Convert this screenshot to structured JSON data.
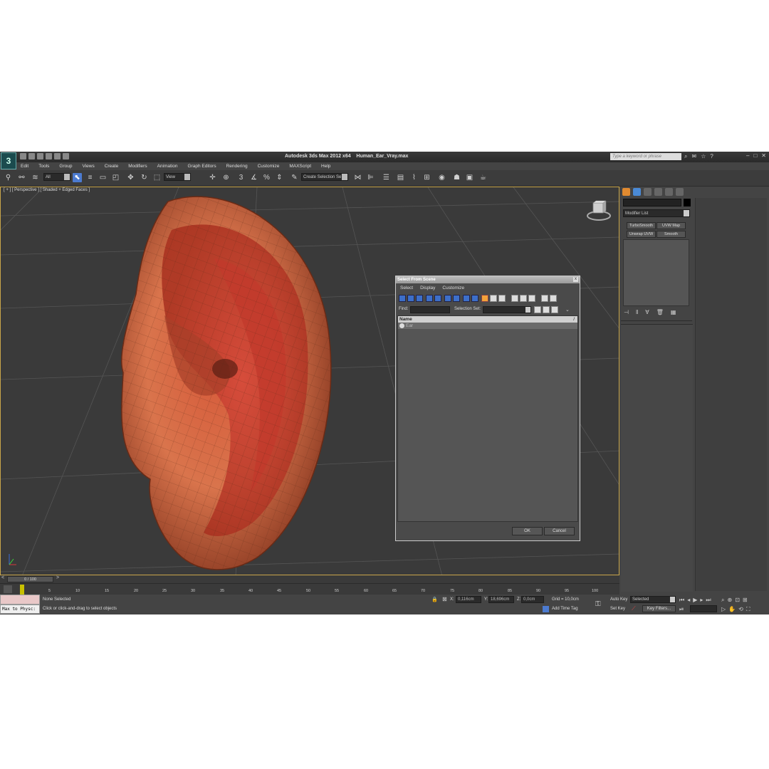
{
  "app": {
    "title_prefix": "Autodesk 3ds Max  2012 x64",
    "file_name": "Human_Ear_Vray.max",
    "search_placeholder": "Type a keyword or phrase"
  },
  "menu": [
    "Edit",
    "Tools",
    "Group",
    "Views",
    "Create",
    "Modifiers",
    "Animation",
    "Graph Editors",
    "Rendering",
    "Customize",
    "MAXScript",
    "Help"
  ],
  "toolbar": {
    "filter_value": "All",
    "coord_value": "View",
    "selection_set_value": "Create Selection Se"
  },
  "viewport": {
    "label": "[ + ] [ Perspective ] [ Shaded + Edged Faces ]"
  },
  "command_panel": {
    "modifier_list": "Modifier List",
    "buttons": [
      "TurboSmooth",
      "UVW Map",
      "Unwrap UVW",
      "Smooth"
    ]
  },
  "dialog": {
    "title": "Select From Scene",
    "close_glyph": "x",
    "menu": [
      "Select",
      "Display",
      "Customize"
    ],
    "find_label": "Find:",
    "selection_set_label": "Selection Set:",
    "column_name": "Name",
    "column_sort": "/",
    "rows": [
      {
        "name": "Ear"
      }
    ],
    "ok_label": "OK",
    "cancel_label": "Cancel"
  },
  "timeline": {
    "frame_label": "0 / 100",
    "ticks": [
      "5",
      "10",
      "15",
      "20",
      "25",
      "30",
      "35",
      "40",
      "45",
      "50",
      "55",
      "60",
      "65",
      "70",
      "75",
      "80",
      "85",
      "90",
      "95",
      "100"
    ]
  },
  "status": {
    "maxscript_text": "Max to Physc:",
    "selection_status": "None Selected",
    "prompt": "Click or click-and-drag to select objects",
    "x_label": "X:",
    "x_value": "0,116cm",
    "y_label": "Y:",
    "y_value": "18,696cm",
    "z_label": "Z:",
    "z_value": "0,0cm",
    "grid": "Grid = 10,0cm",
    "add_time_tag": "Add Time Tag",
    "auto_key": "Auto Key",
    "set_key": "Set Key",
    "selected_value": "Selected",
    "key_filters": "Key Filters..."
  }
}
